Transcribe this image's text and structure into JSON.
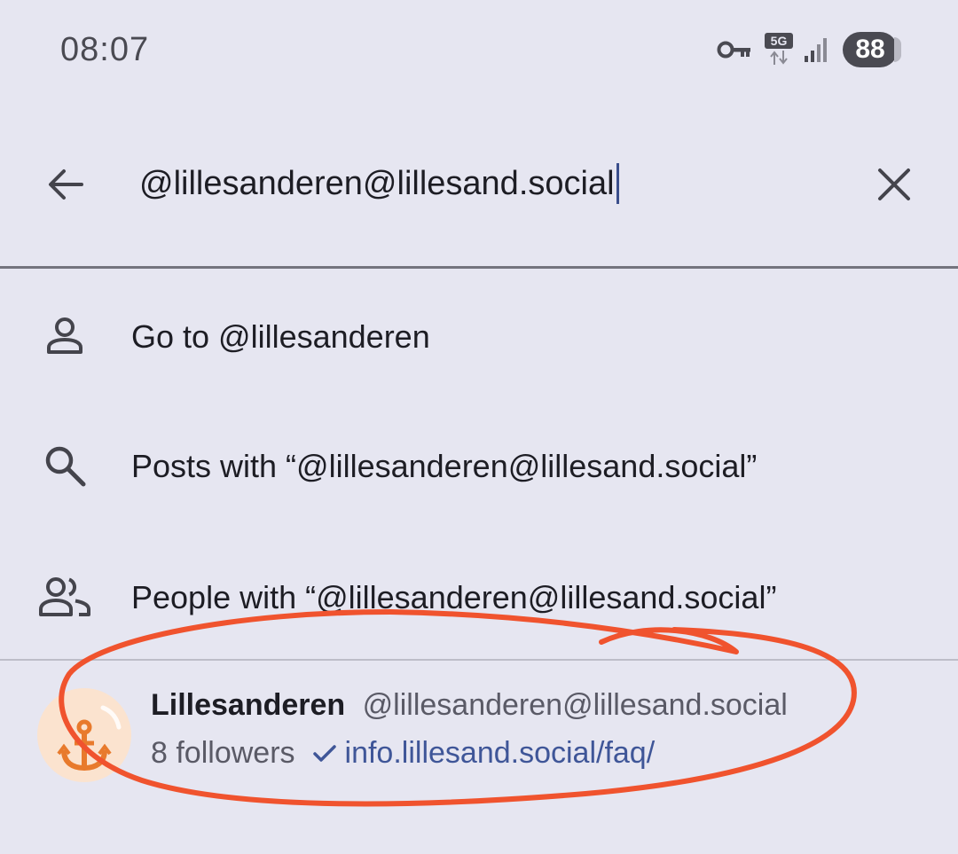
{
  "status_bar": {
    "time": "08:07",
    "network_label": "5G",
    "battery": "88",
    "icons": [
      "vpn-key-icon",
      "network-5g-icon",
      "signal-icon",
      "battery-icon"
    ]
  },
  "search": {
    "query": "@lillesanderen@lillesand.social",
    "back_icon": "arrow-left-icon",
    "clear_icon": "close-icon"
  },
  "suggestions": [
    {
      "icon": "person-icon",
      "label": "Go to @lillesanderen"
    },
    {
      "icon": "search-icon",
      "label": "Posts with “@lillesanderen@lillesand.social”"
    },
    {
      "icon": "people-icon",
      "label": "People with “@lillesanderen@lillesand.social”"
    }
  ],
  "account_result": {
    "display_name": "Lillesanderen",
    "handle": "@lillesanderen@lillesand.social",
    "followers": "8 followers",
    "verified_link": "info.lillesand.social/faq/",
    "avatar_icon": "anchor-icon"
  },
  "colors": {
    "background": "#E6E6F1",
    "text": "#1D1D24",
    "secondary_text": "#5A5A66",
    "link": "#3F5698",
    "annotation": "#F0532E",
    "avatar_bg": "#FBE3CF",
    "avatar_fg": "#E87A2C"
  }
}
